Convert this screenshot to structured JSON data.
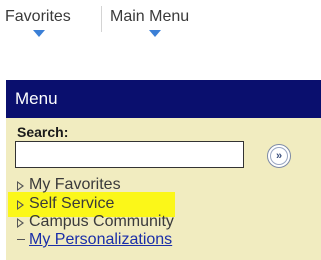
{
  "topnav": {
    "tabs": [
      {
        "label": "Favorites"
      },
      {
        "label": "Main Menu"
      }
    ]
  },
  "menu": {
    "title": "Menu",
    "search": {
      "label": "Search:",
      "value": "",
      "go_symbol": "»"
    },
    "items": [
      {
        "label": "My Favorites",
        "icon": "collapsed-triangle-icon"
      },
      {
        "label": "Self Service",
        "icon": "collapsed-triangle-icon",
        "highlighted": true
      },
      {
        "label": "Campus Community",
        "icon": "collapsed-triangle-icon"
      },
      {
        "label": "My Personalizations",
        "icon": "dash-icon",
        "link": true
      }
    ]
  },
  "colors": {
    "menu_header_bg": "#0a0f6e",
    "menu_bg": "#f1ecc0",
    "highlight": "#fbf719",
    "caret_blue": "#3b7fd6",
    "link": "#1a2ea8"
  }
}
